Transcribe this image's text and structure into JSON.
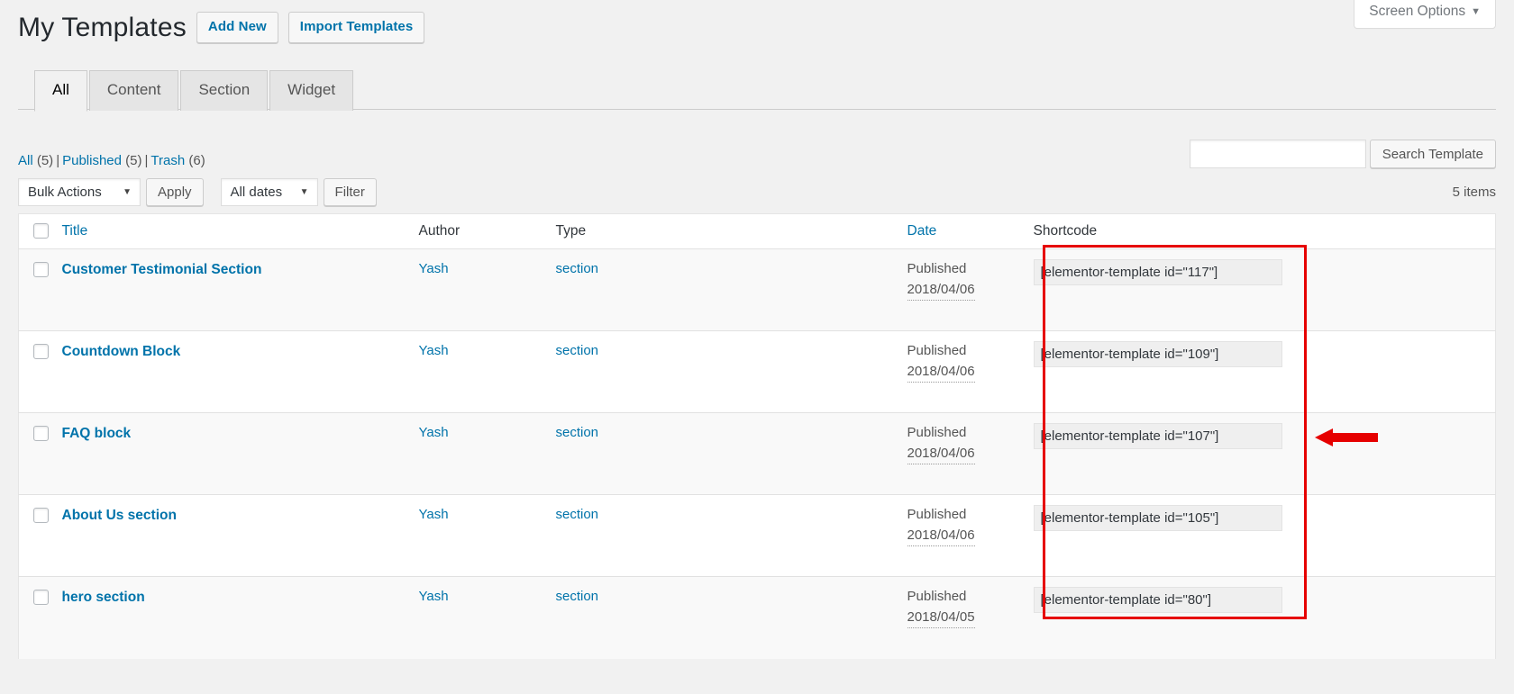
{
  "screen_meta": {
    "screen_options_label": "Screen Options",
    "caret_icon": "chevron-down-icon"
  },
  "header": {
    "title": "My Templates",
    "actions": [
      {
        "label": "Add New",
        "name": "add-new-button"
      },
      {
        "label": "Import Templates",
        "name": "import-templates-button"
      }
    ]
  },
  "tabs": [
    {
      "label": "All",
      "active": true
    },
    {
      "label": "Content",
      "active": false
    },
    {
      "label": "Section",
      "active": false
    },
    {
      "label": "Widget",
      "active": false
    }
  ],
  "status_filters": [
    {
      "label": "All",
      "count": "(5)"
    },
    {
      "label": "Published",
      "count": "(5)"
    },
    {
      "label": "Trash",
      "count": "(6)"
    }
  ],
  "separator": "|",
  "search": {
    "value": "",
    "placeholder": "",
    "submit_label": "Search Template"
  },
  "tablenav": {
    "bulk_actions_label": "Bulk Actions",
    "apply_label": "Apply",
    "dates_label": "All dates",
    "filter_label": "Filter",
    "displaying_num": "5 items",
    "select_arrow_icon": "chevron-down-icon"
  },
  "table": {
    "columns": [
      {
        "label": "Title",
        "sortable": true
      },
      {
        "label": "Author",
        "sortable": false
      },
      {
        "label": "Type",
        "sortable": false
      },
      {
        "label": "Date",
        "sortable": true
      },
      {
        "label": "Shortcode",
        "sortable": false
      }
    ],
    "rows": [
      {
        "title": "Customer Testimonial Section",
        "author": "Yash",
        "type": "section",
        "date_status": "Published",
        "date_value": "2018/04/06",
        "shortcode": "[elementor-template id=\"117\"]"
      },
      {
        "title": "Countdown Block",
        "author": "Yash",
        "type": "section",
        "date_status": "Published",
        "date_value": "2018/04/06",
        "shortcode": "[elementor-template id=\"109\"]"
      },
      {
        "title": "FAQ block",
        "author": "Yash",
        "type": "section",
        "date_status": "Published",
        "date_value": "2018/04/06",
        "shortcode": "[elementor-template id=\"107\"]"
      },
      {
        "title": "About Us section",
        "author": "Yash",
        "type": "section",
        "date_status": "Published",
        "date_value": "2018/04/06",
        "shortcode": "[elementor-template id=\"105\"]"
      },
      {
        "title": "hero section",
        "author": "Yash",
        "type": "section",
        "date_status": "Published",
        "date_value": "2018/04/05",
        "shortcode": "[elementor-template id=\"80\"]"
      }
    ]
  },
  "annotations": {
    "highlight_color": "#e60000",
    "arrow_color": "#e60000",
    "arrow_direction": "left",
    "highlight_target": "shortcode-column"
  }
}
